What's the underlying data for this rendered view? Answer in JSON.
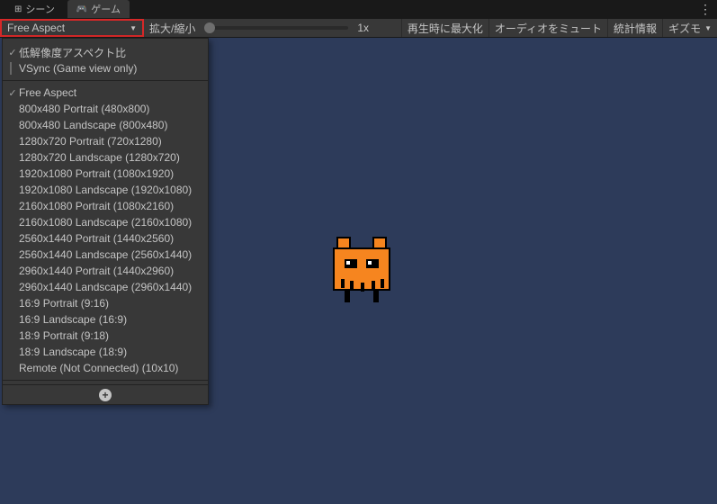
{
  "tabs": {
    "scene": "シーン",
    "game": "ゲーム"
  },
  "toolbar": {
    "aspect_label": "Free Aspect",
    "scale_label": "拡大/縮小",
    "scale_value": "1x",
    "maximize": "再生時に最大化",
    "mute": "オーディオをミュート",
    "stats": "統計情報",
    "gizmos": "ギズモ"
  },
  "dropdown": {
    "low_res": "低解像度アスペクト比",
    "vsync": "VSync (Game view only)",
    "items": [
      "Free Aspect",
      "800x480 Portrait (480x800)",
      "800x480 Landscape (800x480)",
      "1280x720 Portrait (720x1280)",
      "1280x720 Landscape (1280x720)",
      "1920x1080 Portrait (1080x1920)",
      "1920x1080 Landscape (1920x1080)",
      "2160x1080 Portrait (1080x2160)",
      "2160x1080 Landscape (2160x1080)",
      "2560x1440 Portrait (1440x2560)",
      "2560x1440 Landscape (2560x1440)",
      "2960x1440 Portrait (1440x2960)",
      "2960x1440 Landscape (2960x1440)",
      "16:9 Portrait (9:16)",
      "16:9 Landscape (16:9)",
      "18:9 Portrait (9:18)",
      "18:9 Landscape (18:9)",
      "Remote (Not Connected) (10x10)"
    ],
    "selected_index": 0
  }
}
